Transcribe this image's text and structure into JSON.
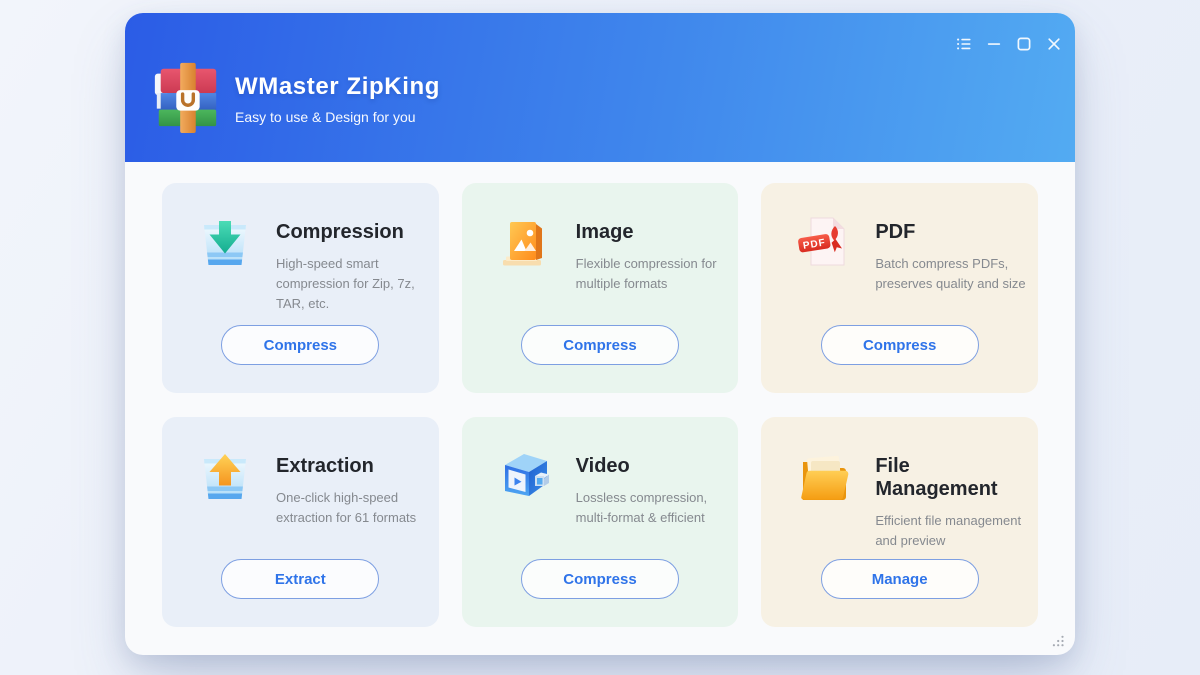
{
  "app": {
    "title": "WMaster ZipKing",
    "subtitle": "Easy to use & Design for you",
    "logo_icon": "winrar-books-logo-icon"
  },
  "window_controls": [
    {
      "id": "menu",
      "icon": "list-menu-icon"
    },
    {
      "id": "minimize",
      "icon": "minimize-icon"
    },
    {
      "id": "maximize",
      "icon": "maximize-icon"
    },
    {
      "id": "close",
      "icon": "close-icon"
    }
  ],
  "cards": [
    {
      "id": "compression",
      "title": "Compression",
      "description": "High-speed smart compression for Zip, 7z, TAR, etc.",
      "button": "Compress",
      "icon": "compress-down-arrow-icon",
      "theme": "blue"
    },
    {
      "id": "image",
      "title": "Image",
      "description": "Flexible compression for multiple formats",
      "button": "Compress",
      "icon": "image-frame-icon",
      "theme": "green"
    },
    {
      "id": "pdf",
      "title": "PDF",
      "description": "Batch compress PDFs, preserves quality and size",
      "button": "Compress",
      "icon": "pdf-file-icon",
      "icon_label": "PDF",
      "theme": "cream"
    },
    {
      "id": "extraction",
      "title": "Extraction",
      "description": "One-click high-speed extraction for 61 formats",
      "button": "Extract",
      "icon": "extract-up-arrow-icon",
      "theme": "blue"
    },
    {
      "id": "video",
      "title": "Video",
      "description": "Lossless compression, multi-format & efficient",
      "button": "Compress",
      "icon": "video-cube-icon",
      "theme": "green"
    },
    {
      "id": "file_management",
      "title": "File Management",
      "description": "Efficient file management and preview",
      "button": "Manage",
      "icon": "folder-icon",
      "theme": "cream"
    }
  ],
  "colors": {
    "header_gradient_start": "#2B5CE6",
    "header_gradient_end": "#53ABF2",
    "accent_blue": "#2F74E9",
    "button_border": "#7D9FE2",
    "card_blue_bg": "#E9EFF8",
    "card_green_bg": "#E9F5EE",
    "card_cream_bg": "#F7F1E4",
    "page_bg": "#EAEFF9",
    "window_bg": "#F9FAFC",
    "title_text": "#23262C",
    "description_text": "#85898F"
  }
}
